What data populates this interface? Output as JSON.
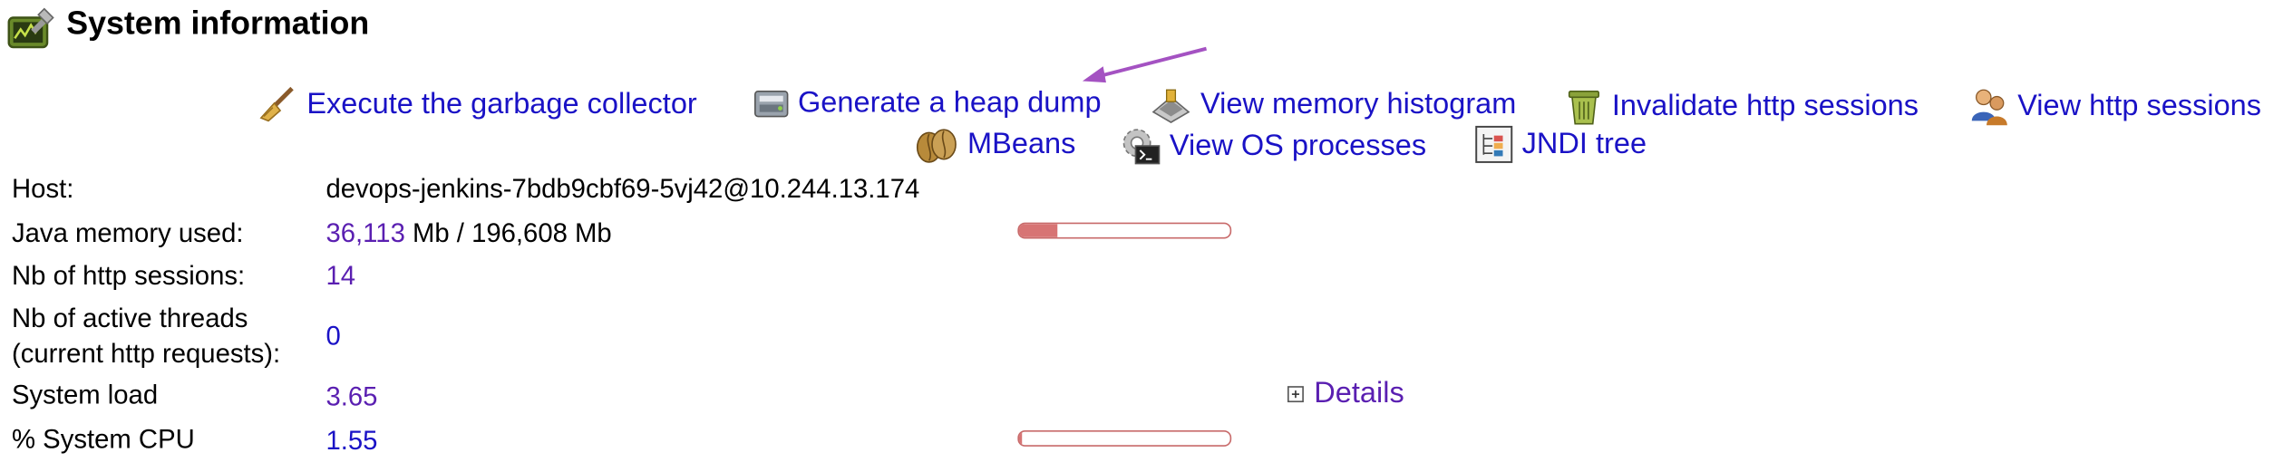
{
  "page": {
    "title": "System information"
  },
  "actions": {
    "gc": "Execute the garbage collector",
    "heap_dump": "Generate a heap dump",
    "histogram": "View memory histogram",
    "invalidate": "Invalidate http sessions",
    "sessions": "View http sessions",
    "mbeans": "MBeans",
    "processes": "View OS processes",
    "jndi": "JNDI tree"
  },
  "info": {
    "host_label": "Host:",
    "host_value": "devops-jenkins-7bdb9cbf69-5vj42@10.244.13.174",
    "memory_label": "Java memory used:",
    "memory_used": "36,113",
    "memory_rest": " Mb / 196,608 Mb",
    "memory_fraction": 0.18,
    "sessions_label": "Nb of http sessions:",
    "sessions_value": "14",
    "threads_label_1": "Nb of active threads",
    "threads_label_2": "(current http requests):",
    "threads_value": "0",
    "load_label": "System load",
    "load_value": "3.65",
    "cpu_label": "% System CPU",
    "cpu_value": "1.55",
    "cpu_fraction": 0.0155,
    "details_label": "Details"
  },
  "colors": {
    "link_blue": "#1a12c6",
    "link_purple": "#5a1fb1",
    "bar_fill": "#d77474",
    "annotation_arrow": "#a452c2"
  },
  "icons": [
    "monitoring-icon",
    "broom-icon",
    "heap-dump-icon",
    "histogram-icon",
    "trash-icon",
    "users-icon",
    "beans-icon",
    "gear-icon",
    "tree-icon",
    "expand-plus-icon"
  ]
}
